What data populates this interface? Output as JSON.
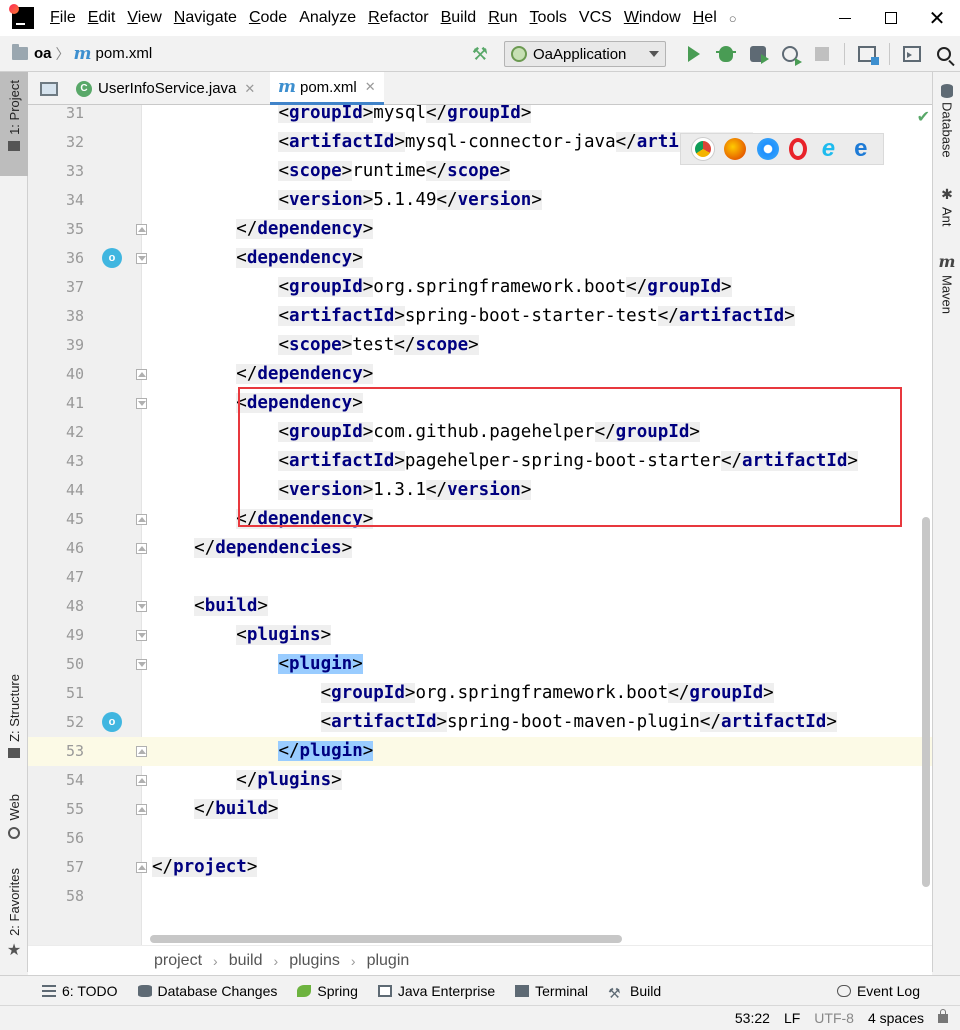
{
  "menu": {
    "items": [
      {
        "label": "File",
        "mnemonic": "F",
        "rest": "ile"
      },
      {
        "label": "Edit",
        "mnemonic": "E",
        "rest": "dit"
      },
      {
        "label": "View",
        "mnemonic": "V",
        "rest": "iew"
      },
      {
        "label": "Navigate",
        "mnemonic": "N",
        "rest": "avigate"
      },
      {
        "label": "Code",
        "mnemonic": "C",
        "rest": "ode"
      },
      {
        "label": "Analyze",
        "mnemonic": "",
        "rest": "Analyze"
      },
      {
        "label": "Refactor",
        "mnemonic": "R",
        "rest": "efactor"
      },
      {
        "label": "Build",
        "mnemonic": "B",
        "rest": "uild"
      },
      {
        "label": "Run",
        "mnemonic": "R",
        "rest": "un"
      },
      {
        "label": "Tools",
        "mnemonic": "T",
        "rest": "ools"
      },
      {
        "label": "VCS",
        "mnemonic": "",
        "rest": "VCS"
      },
      {
        "label": "Window",
        "mnemonic": "W",
        "rest": "indow"
      },
      {
        "label": "Hel",
        "mnemonic": "H",
        "rest": "el"
      }
    ],
    "overflow": "○"
  },
  "nav": {
    "project": "oa",
    "sep": "〉",
    "file": "pom.xml",
    "run_config": "OaApplication"
  },
  "left_tabs": {
    "project": "1: Project",
    "structure": "Z: Structure",
    "web": "Web",
    "favorites": "2: Favorites"
  },
  "right_tabs": {
    "database": "Database",
    "ant": "Ant",
    "maven": "Maven"
  },
  "tabs": [
    {
      "label": "UserInfoService.java",
      "icon": "C",
      "active": false
    },
    {
      "label": "pom.xml",
      "icon": "m",
      "active": true
    }
  ],
  "code_lines": [
    {
      "n": "31",
      "indent": "            ",
      "open": "groupId",
      "text": "mysql",
      "close": "groupId"
    },
    {
      "n": "32",
      "indent": "            ",
      "open": "artifactId",
      "text": "mysql-connector-java",
      "close": "artifactId"
    },
    {
      "n": "33",
      "indent": "            ",
      "open": "scope",
      "text": "runtime",
      "close": "scope"
    },
    {
      "n": "34",
      "indent": "            ",
      "open": "version",
      "text": "5.1.49",
      "close": "version"
    },
    {
      "n": "35",
      "indent": "        ",
      "close_only": "dependency"
    },
    {
      "n": "36",
      "indent": "        ",
      "open_only": "dependency"
    },
    {
      "n": "37",
      "indent": "            ",
      "open": "groupId",
      "text": "org.springframework.boot",
      "close": "groupId"
    },
    {
      "n": "38",
      "indent": "            ",
      "open": "artifactId",
      "text": "spring-boot-starter-test",
      "close": "artifactId"
    },
    {
      "n": "39",
      "indent": "            ",
      "open": "scope",
      "text": "test",
      "close": "scope"
    },
    {
      "n": "40",
      "indent": "        ",
      "close_only": "dependency"
    },
    {
      "n": "41",
      "indent": "        ",
      "open_only": "dependency"
    },
    {
      "n": "42",
      "indent": "            ",
      "open": "groupId",
      "text": "com.github.pagehelper",
      "close": "groupId"
    },
    {
      "n": "43",
      "indent": "            ",
      "open": "artifactId",
      "text": "pagehelper-spring-boot-starter",
      "close": "artifactId"
    },
    {
      "n": "44",
      "indent": "            ",
      "open": "version",
      "text": "1.3.1",
      "close": "version"
    },
    {
      "n": "45",
      "indent": "        ",
      "close_only": "dependency"
    },
    {
      "n": "46",
      "indent": "    ",
      "close_only": "dependencies"
    },
    {
      "n": "47",
      "indent": "",
      "empty": true
    },
    {
      "n": "48",
      "indent": "    ",
      "open_only": "build"
    },
    {
      "n": "49",
      "indent": "        ",
      "open_only": "plugins"
    },
    {
      "n": "50",
      "indent": "            ",
      "open_only": "plugin",
      "highlight": true
    },
    {
      "n": "51",
      "indent": "                ",
      "open": "groupId",
      "text": "org.springframework.boot",
      "close": "groupId"
    },
    {
      "n": "52",
      "indent": "                ",
      "open": "artifactId",
      "text": "spring-boot-maven-plugin",
      "close": "artifactId"
    },
    {
      "n": "53",
      "indent": "            ",
      "close_only": "plugin",
      "highlight": true,
      "current": true
    },
    {
      "n": "54",
      "indent": "        ",
      "close_only": "plugins"
    },
    {
      "n": "55",
      "indent": "    ",
      "close_only": "build"
    },
    {
      "n": "56",
      "indent": "",
      "empty": true
    },
    {
      "n": "57",
      "indent": "",
      "close_only": "project"
    },
    {
      "n": "58",
      "indent": "",
      "empty": true
    }
  ],
  "breadcrumb": [
    "project",
    "build",
    "plugins",
    "plugin"
  ],
  "breadcrumb_sep": "›",
  "tool_windows": [
    {
      "label": "6: TODO",
      "icon": "list"
    },
    {
      "label": "Database Changes",
      "icon": "db"
    },
    {
      "label": "Spring",
      "icon": "spring"
    },
    {
      "label": "Java Enterprise",
      "icon": "je"
    },
    {
      "label": "Terminal",
      "icon": "term"
    },
    {
      "label": "Build",
      "icon": "build"
    }
  ],
  "event_log": "Event Log",
  "status": {
    "position": "53:22",
    "line_sep": "LF",
    "encoding": "UTF-8",
    "indent": "4 spaces"
  },
  "colors": {
    "tag": "#000080",
    "highlight_box": "#e8383d",
    "accent": "#4083c9"
  }
}
